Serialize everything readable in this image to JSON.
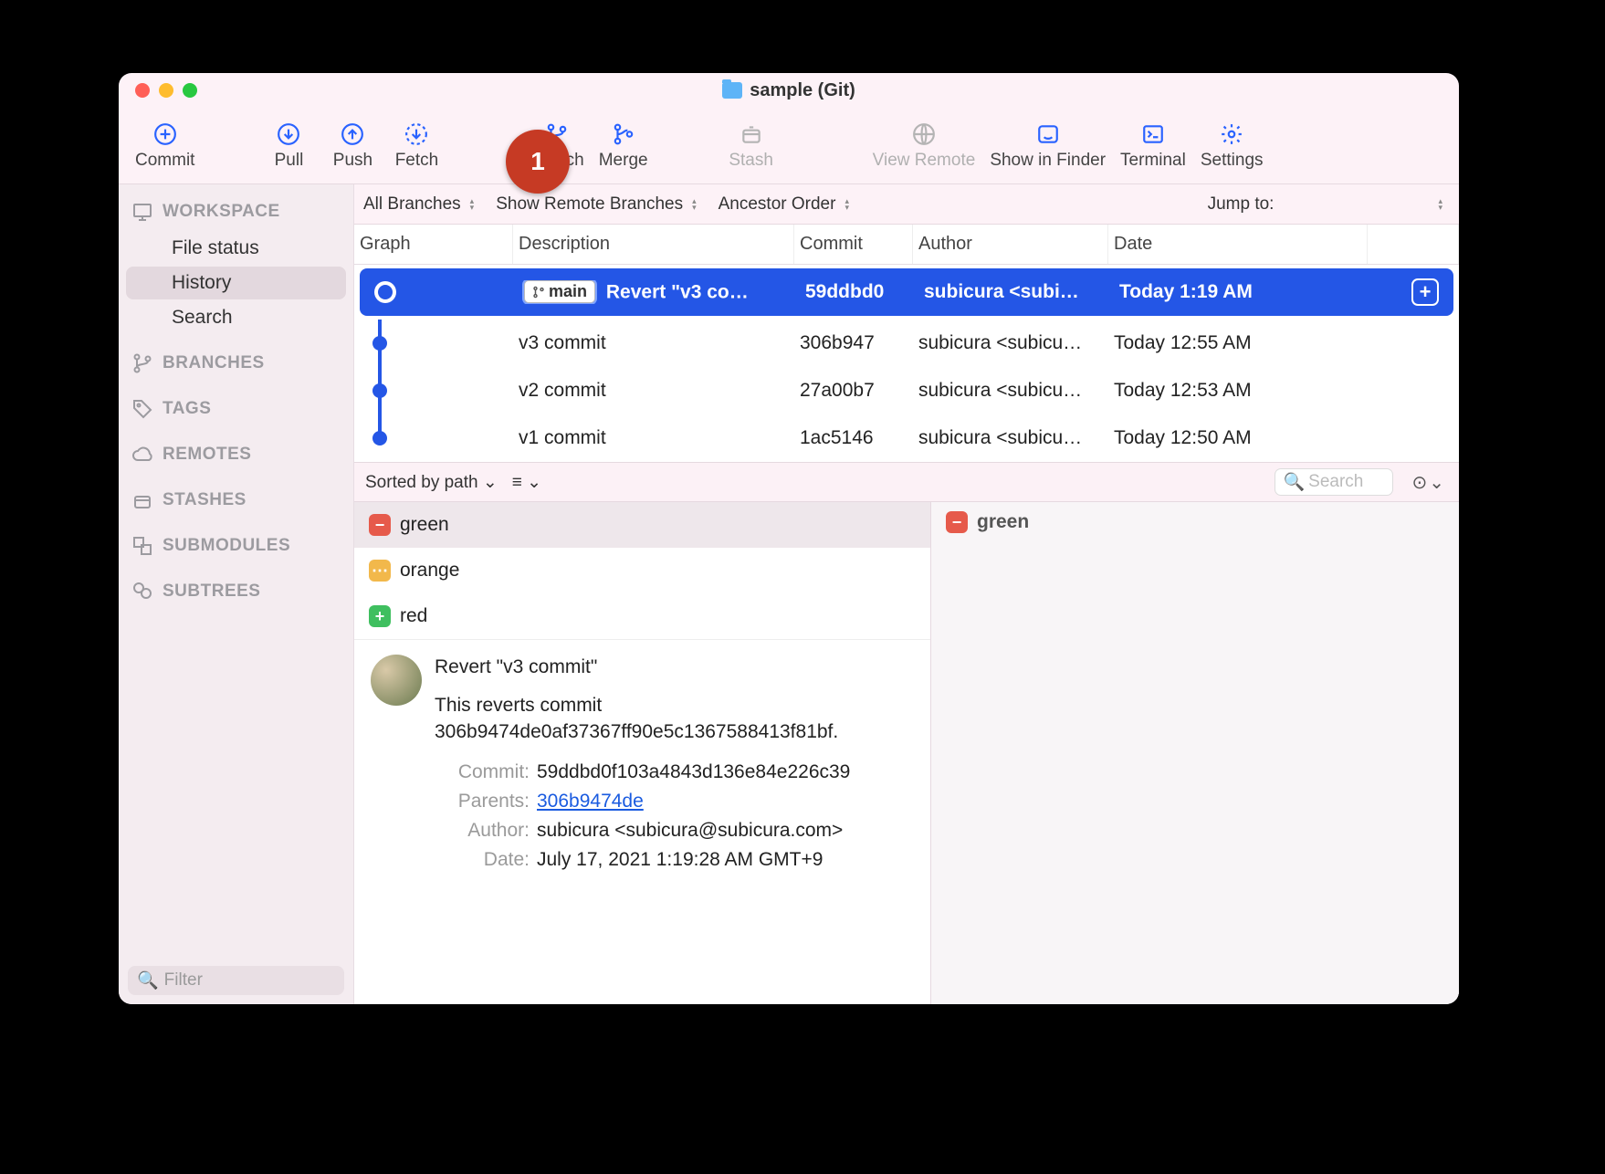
{
  "window": {
    "title": "sample (Git)"
  },
  "badge": "1",
  "toolbar": [
    {
      "name": "commit",
      "label": "Commit",
      "icon": "plus-circle"
    },
    {
      "name": "pull",
      "label": "Pull",
      "icon": "arrow-down-circle"
    },
    {
      "name": "push",
      "label": "Push",
      "icon": "arrow-up-circle"
    },
    {
      "name": "fetch",
      "label": "Fetch",
      "icon": "dotted-down-circle"
    },
    {
      "name": "branch",
      "label": "Branch",
      "icon": "branch"
    },
    {
      "name": "merge",
      "label": "Merge",
      "icon": "merge"
    },
    {
      "name": "stash",
      "label": "Stash",
      "icon": "stash",
      "dim": true
    },
    {
      "name": "view-remote",
      "label": "View Remote",
      "icon": "globe",
      "dim": true
    },
    {
      "name": "show-finder",
      "label": "Show in Finder",
      "icon": "finder"
    },
    {
      "name": "terminal",
      "label": "Terminal",
      "icon": "terminal"
    },
    {
      "name": "settings",
      "label": "Settings",
      "icon": "gear"
    }
  ],
  "sidebar": {
    "sections": [
      {
        "name": "workspace",
        "label": "WORKSPACE",
        "items": [
          {
            "label": "File status",
            "name": "file-status"
          },
          {
            "label": "History",
            "name": "history",
            "selected": true
          },
          {
            "label": "Search",
            "name": "search"
          }
        ]
      },
      {
        "name": "branches",
        "label": "BRANCHES",
        "items": []
      },
      {
        "name": "tags",
        "label": "TAGS",
        "items": []
      },
      {
        "name": "remotes",
        "label": "REMOTES",
        "items": []
      },
      {
        "name": "stashes",
        "label": "STASHES",
        "items": []
      },
      {
        "name": "submodules",
        "label": "SUBMODULES",
        "items": []
      },
      {
        "name": "subtrees",
        "label": "SUBTREES",
        "items": []
      }
    ],
    "filter_placeholder": "Filter"
  },
  "filterbar": {
    "branches": "All Branches",
    "remote": "Show Remote Branches",
    "order": "Ancestor Order",
    "jump": "Jump to:"
  },
  "columns": {
    "graph": "Graph",
    "desc": "Description",
    "commit": "Commit",
    "author": "Author",
    "date": "Date"
  },
  "commits": [
    {
      "branch": "main",
      "desc": "Revert \"v3 co…",
      "hash": "59ddbd0",
      "author": "subicura <subi…",
      "date": "Today 1:19 AM",
      "selected": true
    },
    {
      "desc": "v3 commit",
      "hash": "306b947",
      "author": "subicura <subicu…",
      "date": "Today 12:55 AM"
    },
    {
      "desc": "v2 commit",
      "hash": "27a00b7",
      "author": "subicura <subicu…",
      "date": "Today 12:53 AM"
    },
    {
      "desc": "v1 commit",
      "hash": "1ac5146",
      "author": "subicura <subicu…",
      "date": "Today 12:50 AM"
    }
  ],
  "midbar": {
    "sort": "Sorted by path",
    "view": "≡",
    "search_placeholder": "Search"
  },
  "files": [
    {
      "name": "green",
      "status": "del",
      "selected": true
    },
    {
      "name": "orange",
      "status": "mod"
    },
    {
      "name": "red",
      "status": "add"
    }
  ],
  "detail": {
    "subject": "Revert \"v3 commit\"",
    "body": "This reverts commit 306b9474de0af37367ff90e5c1367588413f81bf.",
    "commit_label": "Commit:",
    "commit": "59ddbd0f103a4843d136e84e226c39",
    "parents_label": "Parents:",
    "parent": "306b9474de",
    "author_label": "Author:",
    "author": "subicura <subicura@subicura.com>",
    "date_label": "Date:",
    "date": "July 17, 2021 1:19:28 AM GMT+9"
  },
  "diff": {
    "file": "green",
    "status": "del"
  }
}
